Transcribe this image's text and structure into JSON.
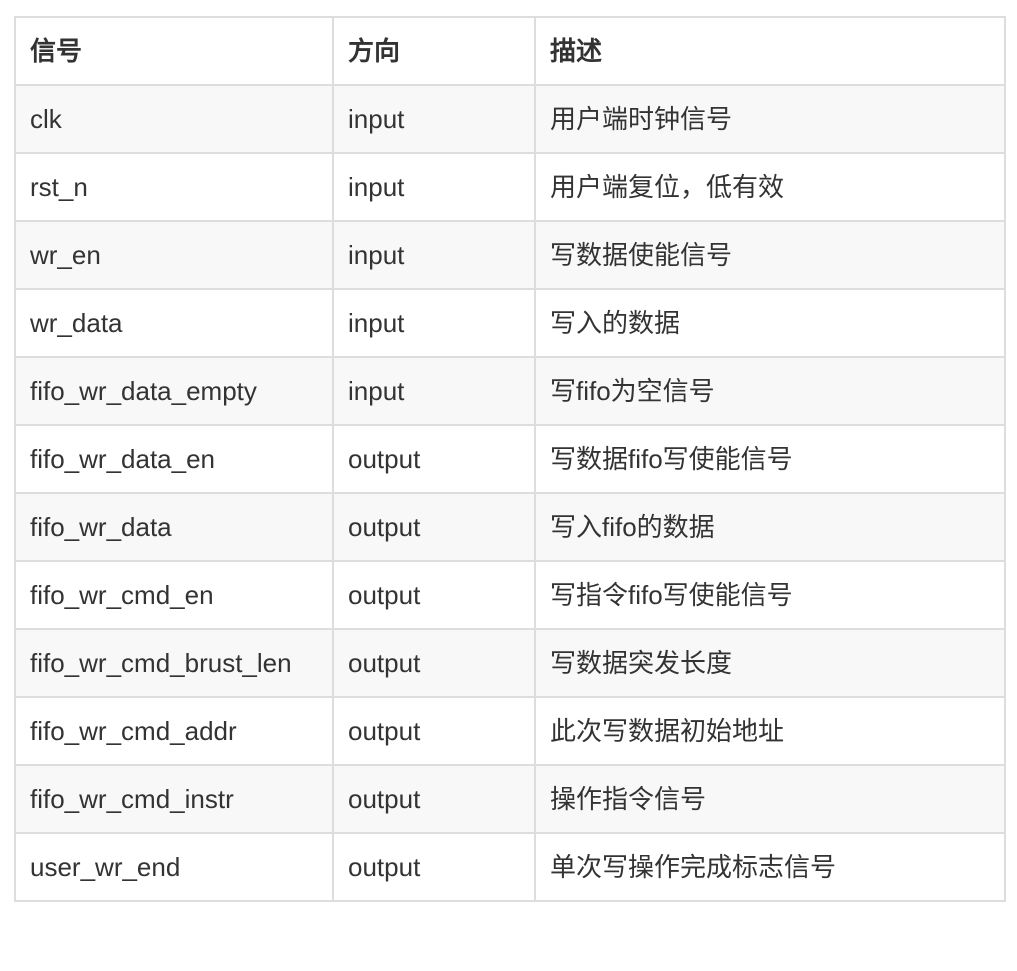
{
  "table": {
    "headers": [
      "信号",
      "方向",
      "描述"
    ],
    "rows": [
      [
        "clk",
        "input",
        "用户端时钟信号"
      ],
      [
        "rst_n",
        "input",
        "用户端复位，低有效"
      ],
      [
        "wr_en",
        "input",
        "写数据使能信号"
      ],
      [
        "wr_data",
        "input",
        "写入的数据"
      ],
      [
        "fifo_wr_data_empty",
        "input",
        "写fifo为空信号"
      ],
      [
        "fifo_wr_data_en",
        "output",
        "写数据fifo写使能信号"
      ],
      [
        "fifo_wr_data",
        "output",
        "写入fifo的数据"
      ],
      [
        "fifo_wr_cmd_en",
        "output",
        "写指令fifo写使能信号"
      ],
      [
        "fifo_wr_cmd_brust_len",
        "output",
        "写数据突发长度"
      ],
      [
        "fifo_wr_cmd_addr",
        "output",
        "此次写数据初始地址"
      ],
      [
        "fifo_wr_cmd_instr",
        "output",
        "操作指令信号"
      ],
      [
        "user_wr_end",
        "output",
        "单次写操作完成标志信号"
      ]
    ]
  }
}
